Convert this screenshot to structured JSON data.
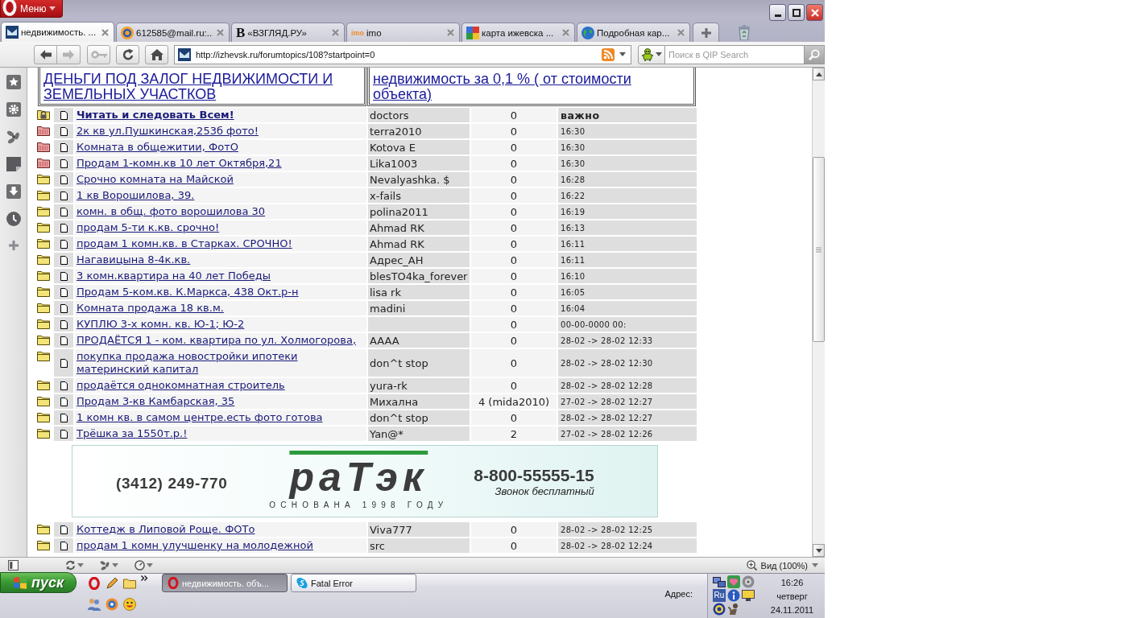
{
  "window": {
    "menu_label": "Меню"
  },
  "tabs": [
    {
      "title": "недвижимость. ...",
      "selected": true
    },
    {
      "title": "612585@mail.ru:...",
      "selected": false
    },
    {
      "favicon_text": "B",
      "title": "«ВЗГЛЯД.РУ»",
      "selected": false
    },
    {
      "favicon_text": "imo",
      "title": "imo",
      "selected": false
    },
    {
      "title": "карта ижевска ...",
      "selected": false
    },
    {
      "title": "Подробная кар...",
      "selected": false
    }
  ],
  "toolbar": {
    "buttons": [
      {
        "kind": "back",
        "disabled": false
      },
      {
        "kind": "forward",
        "disabled": true
      },
      {
        "kind": "key",
        "disabled": true
      },
      {
        "kind": "reload",
        "disabled": false
      },
      {
        "kind": "home",
        "disabled": false
      }
    ],
    "url": "http://izhevsk.ru/forumtopics/108?startpoint=0",
    "search_placeholder": "Поиск в QIP Search"
  },
  "ads": [
    {
      "text": "ДЕНЬГИ ПОД ЗАЛОГ НЕДВИЖИМОСТИ И ЗЕМЕЛЬНЫХ УЧАСТКОВ"
    },
    {
      "text": "недвижимость за 0,1 % ( от стоимости объекта)"
    }
  ],
  "topics": [
    {
      "kind": "sticky",
      "title": "Читать и следовать Всем!",
      "author": "doctors",
      "replies": "0",
      "last_post": "важно"
    },
    {
      "kind": "hot",
      "title": "2к кв ул.Пушкинская,253б фото!",
      "author": "terra2010",
      "replies": "0",
      "last_post": "16:30"
    },
    {
      "kind": "hot",
      "title": "Комната в общежитии, ФотО",
      "author": "Kotova E",
      "replies": "0",
      "last_post": "16:30"
    },
    {
      "kind": "hot",
      "title": "Продам 1-комн.кв 10 лет Октября,21",
      "author": "Lika1003",
      "replies": "0",
      "last_post": "16:30"
    },
    {
      "kind": "normal",
      "title": "Срочно комната на Майской",
      "author": "Nevalyashka. $",
      "replies": "0",
      "last_post": "16:28"
    },
    {
      "kind": "normal",
      "title": "1 кв Ворошилова, 39.",
      "author": "x-fails",
      "replies": "0",
      "last_post": "16:22"
    },
    {
      "kind": "normal",
      "title": "комн. в общ. фото ворошилова 30",
      "author": "polina2011",
      "replies": "0",
      "last_post": "16:19"
    },
    {
      "kind": "normal",
      "title": "продам 5-ти к.кв. срочно!",
      "author": "Ahmad RK",
      "replies": "0",
      "last_post": "16:13"
    },
    {
      "kind": "normal",
      "title": "продам 1 комн.кв. в Старках. СРОЧНО!",
      "author": "Ahmad RK",
      "replies": "0",
      "last_post": "16:11"
    },
    {
      "kind": "normal",
      "title": "Нагавицына 8-4к.кв.",
      "author": "Адрес_АН",
      "replies": "0",
      "last_post": "16:11"
    },
    {
      "kind": "normal",
      "title": "3 комн.квартира на 40 лет Победы",
      "author": "blesTO4ka_forever",
      "replies": "0",
      "last_post": "16:10"
    },
    {
      "kind": "normal",
      "title": "Продам 5-ком.кв. К.Маркса, 438 Окт.р-н",
      "author": "lisa rk",
      "replies": "0",
      "last_post": "16:05"
    },
    {
      "kind": "normal",
      "title": "Комната продажа 18 кв.м.",
      "author": "madini",
      "replies": "0",
      "last_post": "16:04"
    },
    {
      "kind": "normal",
      "title": "КУПЛЮ 3-х комн. кв. Ю-1; Ю-2",
      "replies": "0",
      "last_post": "00-00-0000 00:"
    },
    {
      "kind": "normal",
      "title": "ПРОДАЁТСЯ 1 - ком. квартира по ул. Холмогорова,",
      "author": "AAAA",
      "replies": "0",
      "last_post": "28-02 -> 28-02 12:33"
    },
    {
      "kind": "normal",
      "title": "покупка продажа новостройки ипотеки материнский капитал",
      "author": "don^t stop",
      "replies": "0",
      "last_post": "28-02 -> 28-02 12:30"
    },
    {
      "kind": "normal",
      "title": "продаётся однокомнатная строитель",
      "author": "yura-rk",
      "replies": "0",
      "last_post": "28-02 -> 28-02 12:28"
    },
    {
      "kind": "normal",
      "title": "Продам 3-кв Камбарская, 35",
      "author": "Михална",
      "replies": "4 (mida2010)",
      "last_post": "27-02 -> 28-02 12:27"
    },
    {
      "kind": "normal",
      "title": "1 комн кв. в самом центре.есть фото готова",
      "author": "don^t stop",
      "replies": "0",
      "last_post": "28-02 -> 28-02 12:27"
    },
    {
      "kind": "normal",
      "title": "Трёшка за 1550т.р.!",
      "author": "Yan@*",
      "replies": "2",
      "last_post": "27-02 -> 28-02 12:26"
    }
  ],
  "banner": {
    "phone": "(3412) 249-770",
    "logo": "раТэк",
    "tagline": "ОСНОВАНА 1998 ГОДУ",
    "toll_free_phone": "8-800-55555-15",
    "note": "Звонок бесплатный"
  },
  "more_topics": [
    {
      "kind": "normal",
      "title": "Коттедж в Липовой Роще. ФОТо",
      "author": "Viva777",
      "replies": "0",
      "last_post": "28-02 -> 28-02 12:25"
    },
    {
      "kind": "normal",
      "title": "продам 1 комн улучшенку на молодежной",
      "author": "src",
      "replies": "0",
      "last_post": "28-02 -> 28-02 12:24"
    }
  ],
  "status_bar": {
    "zoom": "Вид (100%)"
  },
  "taskbar": {
    "start_label": "пуск",
    "tasks": [
      {
        "title": "недвижимость. объ...",
        "selected": true
      },
      {
        "title": "Fatal Error",
        "selected": false
      }
    ],
    "address_label": "Адрес:",
    "language": "Ru",
    "time": "16:26",
    "weekday": "четверг",
    "date": "24.11.2011"
  }
}
